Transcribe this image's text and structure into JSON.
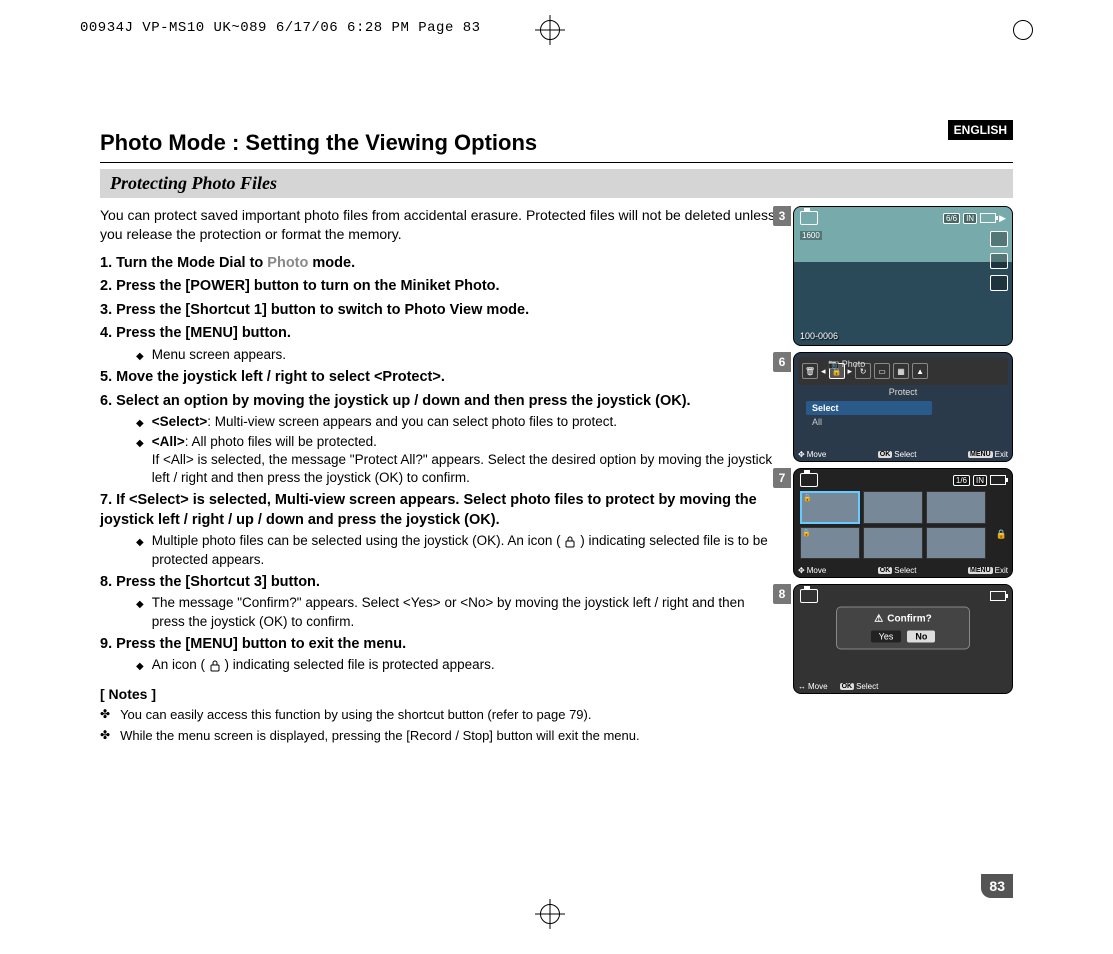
{
  "print_header": "00934J VP-MS10 UK~089  6/17/06 6:28 PM  Page 83",
  "language_tag": "ENGLISH",
  "title": "Photo Mode : Setting the Viewing Options",
  "subtitle": "Protecting Photo Files",
  "intro": "You can protect saved important photo files from accidental erasure. Protected files will not be deleted unless you release the protection or format the memory.",
  "steps": {
    "s1_num": "1.",
    "s1_a": "Turn the Mode Dial to ",
    "s1_photo": "Photo",
    "s1_b": " mode.",
    "s2": "2. Press the [POWER] button to turn on the Miniket Photo.",
    "s3": "3. Press the [Shortcut 1] button to switch to Photo View mode.",
    "s4": "4. Press the [MENU] button.",
    "s4_sub": "Menu screen appears.",
    "s5": "5. Move the joystick left / right to select <Protect>.",
    "s6": "6. Select an option by moving the joystick up / down and then press the joystick (OK).",
    "s6_sub1_b": "<Select>",
    "s6_sub1_t": ": Multi-view screen appears and you can select photo files to protect.",
    "s6_sub2_b": "<All>",
    "s6_sub2_t": ": All photo files will be protected.",
    "s6_sub2_extra": "If <All> is selected, the message \"Protect All?\" appears. Select the desired option by moving the joystick left / right and then press the joystick (OK) to confirm.",
    "s7": "7. If <Select> is selected, Multi-view screen appears. Select photo files to protect by moving the joystick left / right / up / down and press the joystick (OK).",
    "s7_sub_a": "Multiple photo files can be selected using the joystick (OK). An icon (",
    "s7_sub_b": ") indicating selected file is to be protected appears.",
    "s8": "8. Press the [Shortcut 3] button.",
    "s8_sub": "The message \"Confirm?\" appears. Select <Yes> or <No> by moving the joystick left / right and then press the joystick (OK) to confirm.",
    "s9": "9. Press the [MENU] button to exit the menu.",
    "s9_sub_a": "An icon (",
    "s9_sub_b": ") indicating selected file is protected appears."
  },
  "notes_head": "[ Notes ]",
  "notes": {
    "n1": "You can easily access this function by using the shortcut button (refer to page 79).",
    "n2": "While the menu screen is displayed, pressing the [Record / Stop] button will exit the menu."
  },
  "screens": {
    "badge3": "3",
    "badge6": "6",
    "badge7": "7",
    "badge8": "8",
    "s3_counter": "6/6",
    "s3_in": "IN",
    "s3_folder": "100-0006",
    "s3_size": "1600",
    "s6_photo": "Photo",
    "s6_protect": "Protect",
    "s6_opt1": "Select",
    "s6_opt2": "All",
    "s7_counter": "1/6",
    "s7_in": "IN",
    "s8_confirm": "Confirm?",
    "s8_yes": "Yes",
    "s8_no": "No",
    "bb_move": "Move",
    "bb_ok": "OK",
    "bb_select": "Select",
    "bb_menu": "MENU",
    "bb_exit": "Exit"
  },
  "page_number": "83"
}
